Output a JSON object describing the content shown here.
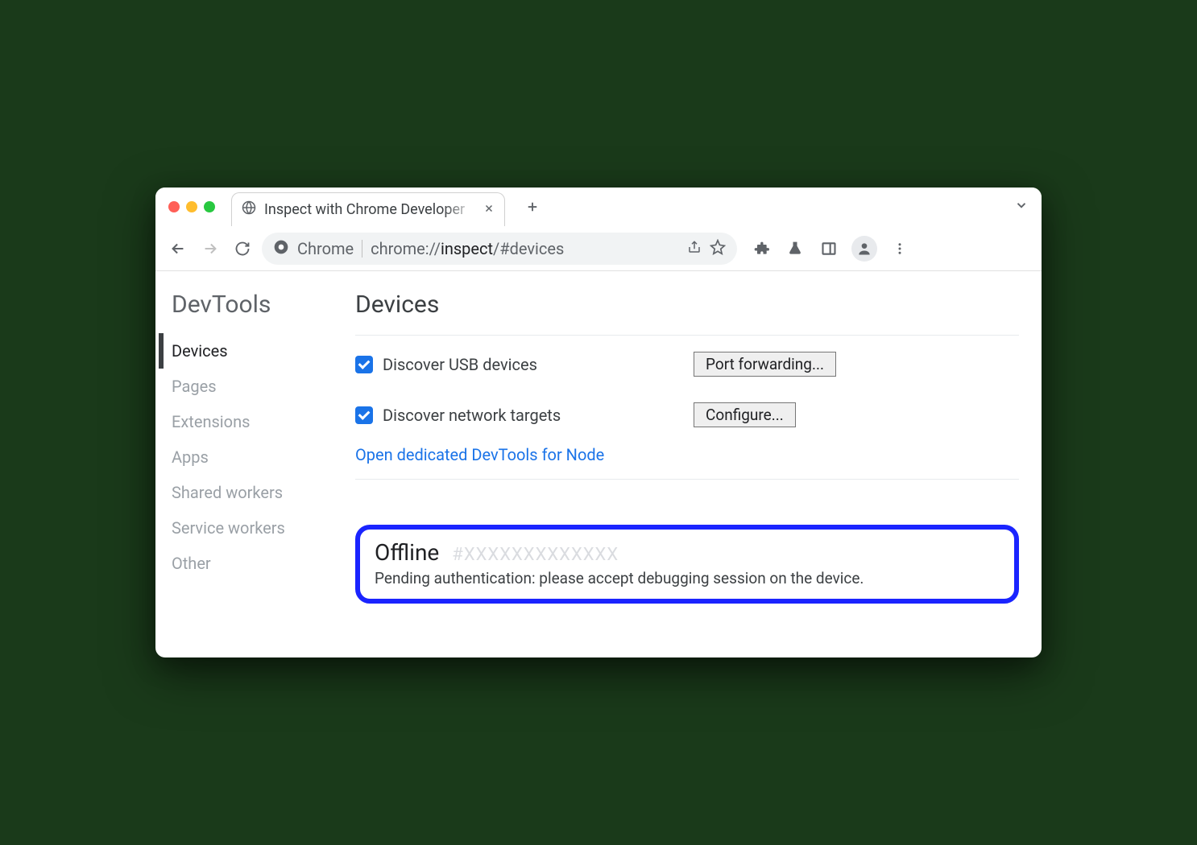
{
  "tab": {
    "title": "Inspect with Chrome Developer"
  },
  "address": {
    "label": "Chrome",
    "url_prefix": "chrome://",
    "url_path": "inspect",
    "url_suffix": "/#devices"
  },
  "sidebar": {
    "title": "DevTools",
    "items": [
      {
        "label": "Devices",
        "active": true
      },
      {
        "label": "Pages",
        "active": false
      },
      {
        "label": "Extensions",
        "active": false
      },
      {
        "label": "Apps",
        "active": false
      },
      {
        "label": "Shared workers",
        "active": false
      },
      {
        "label": "Service workers",
        "active": false
      },
      {
        "label": "Other",
        "active": false
      }
    ]
  },
  "main": {
    "title": "Devices",
    "settings": {
      "usb_label": "Discover USB devices",
      "usb_checked": true,
      "usb_button": "Port forwarding...",
      "network_label": "Discover network targets",
      "network_checked": true,
      "network_button": "Configure...",
      "node_link": "Open dedicated DevTools for Node"
    },
    "device": {
      "status": "Offline",
      "id": "#XXXXXXXXXXXXX",
      "message": "Pending authentication: please accept debugging session on the device."
    }
  }
}
